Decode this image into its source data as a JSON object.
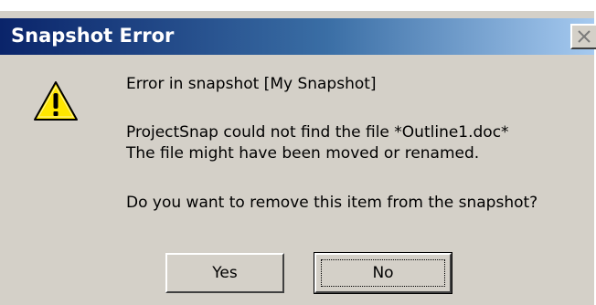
{
  "window": {
    "title": "Snapshot Error"
  },
  "icons": {
    "close": "close-icon",
    "warning": "warning-icon"
  },
  "message": {
    "line1": "Error in snapshot [My Snapshot]",
    "line2": "ProjectSnap could not find the file *Outline1.doc*",
    "line3": "The file might have been moved or renamed.",
    "line4": "Do you want to remove this item from the snapshot?"
  },
  "buttons": {
    "yes_label": "Yes",
    "no_label": "No"
  },
  "colors": {
    "titlebar_start": "#0a246a",
    "titlebar_end": "#a6caf0",
    "face": "#d4d0c8",
    "warning_yellow": "#ffe600"
  }
}
